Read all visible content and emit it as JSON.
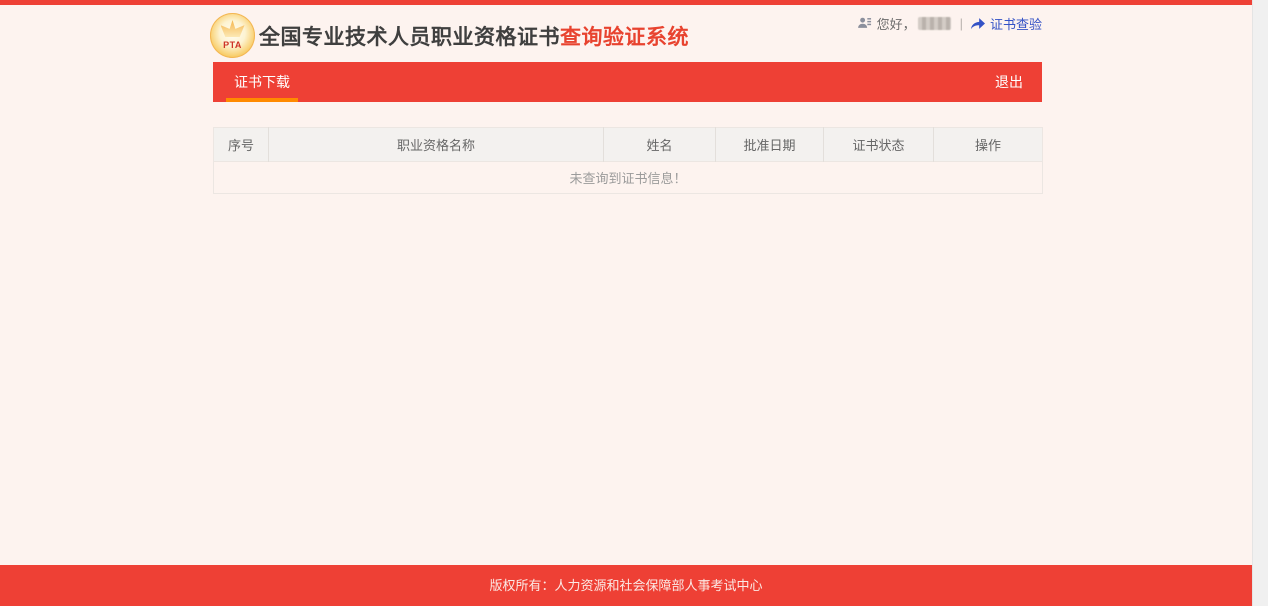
{
  "theme": {
    "accent_red": "#ee4035",
    "accent_orange": "#ff8a00",
    "link_blue": "#3452c6",
    "page_background": "#fdf3ef"
  },
  "header": {
    "logo_text": "PTA",
    "title_main": "全国专业技术人员职业资格证书",
    "title_accent": "查询验证系统",
    "greeting": "您好，",
    "divider": "|",
    "verify_link": "证书查验"
  },
  "nav": {
    "active_tab": "证书下载",
    "logout": "退出"
  },
  "table": {
    "columns": [
      "序号",
      "职业资格名称",
      "姓名",
      "批准日期",
      "证书状态",
      "操作"
    ],
    "empty_message": "未查询到证书信息！"
  },
  "footer": {
    "copyright": "版权所有：人力资源和社会保障部人事考试中心"
  }
}
